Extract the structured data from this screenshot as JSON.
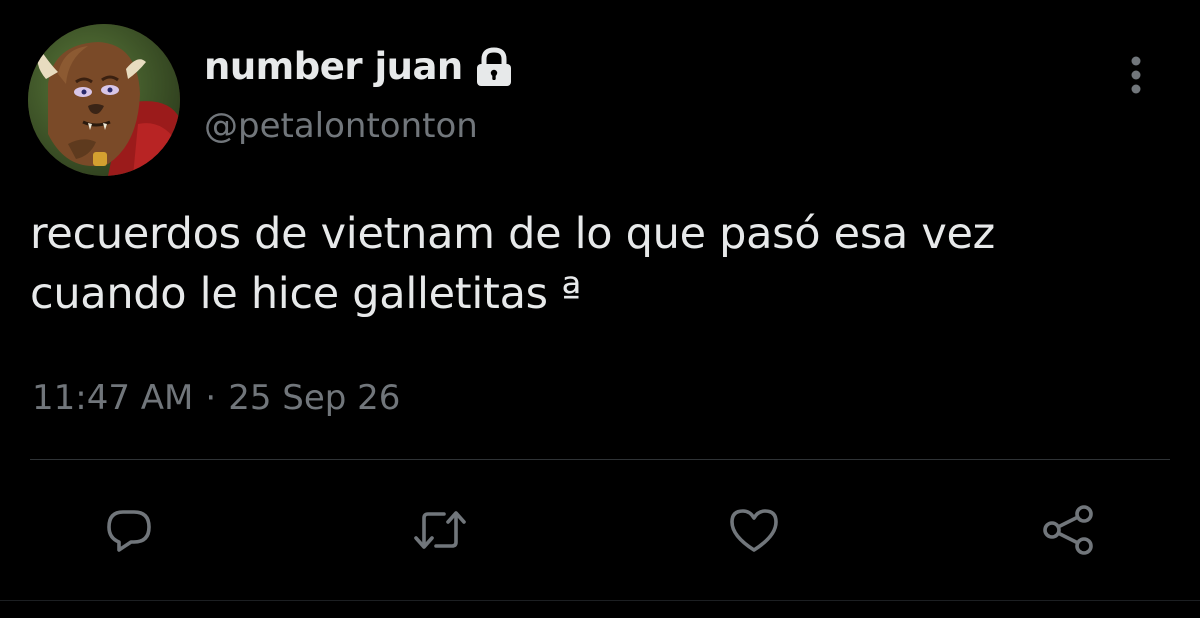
{
  "tweet": {
    "display_name": "number juan",
    "handle": "@petalontonton",
    "text_lines": [
      "recuerdos de vietnam de lo que pasó esa vez",
      "cuando le hice galletitas ª"
    ],
    "time": "11:47 AM",
    "separator": "·",
    "date": "25 Sep 26"
  },
  "icons": {
    "protected": "lock-icon",
    "more": "more-vertical-icon",
    "reply": "reply-icon",
    "retweet": "retweet-icon",
    "like": "heart-icon",
    "share": "share-icon"
  },
  "colors": {
    "background": "#000000",
    "primary_text": "#e7e9ea",
    "secondary_text": "#71767b",
    "divider": "#2f3336"
  }
}
